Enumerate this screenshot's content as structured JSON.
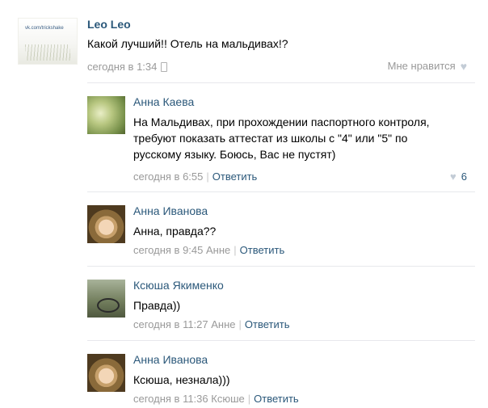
{
  "post": {
    "avatar_watermark": "vk.com/trickshake",
    "author": "Leo Leo",
    "text": "Какой лучший!! Отель на мальдивах!?",
    "time": "сегодня в 1:34",
    "device_icon": "phone-icon",
    "like_label": "Мне нравится",
    "like_icon": "heart-icon"
  },
  "comments": [
    {
      "author": "Анна Каева",
      "lines": [
        "На Мальдивах, при прохождении паспортного контроля,",
        "требуют показать аттестат из школы с \"4\" или \"5\" по",
        "русскому языку. Боюсь, Вас не пустят)"
      ],
      "time": "сегодня в 6:55",
      "reply_to": "",
      "reply_label": "Ответить",
      "likes": "6"
    },
    {
      "author": "Анна Иванова",
      "lines": [
        "Анна, правда??"
      ],
      "time": "сегодня в 9:45",
      "reply_to": "Анне",
      "reply_label": "Ответить"
    },
    {
      "author": "Ксюша Якименко",
      "lines": [
        "Правда))"
      ],
      "time": "сегодня в 11:27",
      "reply_to": "Анне",
      "reply_label": "Ответить"
    },
    {
      "author": "Анна Иванова",
      "lines": [
        "Ксюша, незнала)))"
      ],
      "time": "сегодня в 11:36",
      "reply_to": "Ксюше",
      "reply_label": "Ответить"
    }
  ]
}
